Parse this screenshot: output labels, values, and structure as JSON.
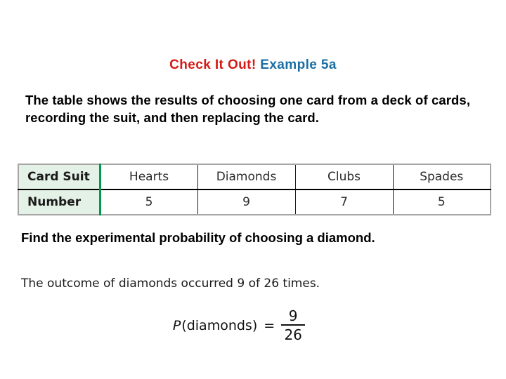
{
  "slide": {
    "title": {
      "part_red": "Check It Out!",
      "part_blue": " Example 5a"
    },
    "intro_text": "The table shows the results of choosing one card from a deck of cards, recording the suit, and then replacing the card.",
    "table": {
      "row_label_header": "Card Suit",
      "row_label_number": "Number",
      "columns": [
        "Hearts",
        "Diamonds",
        "Clubs",
        "Spades"
      ],
      "values": [
        "5",
        "9",
        "7",
        "5"
      ],
      "accent_color": "#00994d",
      "label_cell_bg": "#e4f1e6",
      "border_color": "#a6a6a6"
    },
    "question_text": "Find the experimental probability of choosing a diamond.",
    "outcome_text": "The outcome of diamonds occurred 9 of 26 times.",
    "formula": {
      "function_name": "P",
      "argument": "(diamonds)",
      "equals": "=",
      "numerator": "9",
      "denominator": "26"
    }
  },
  "colors": {
    "title_red": "#d61a16",
    "title_blue": "#1b6ea4",
    "background": "#ffffff",
    "text": "#000000"
  }
}
